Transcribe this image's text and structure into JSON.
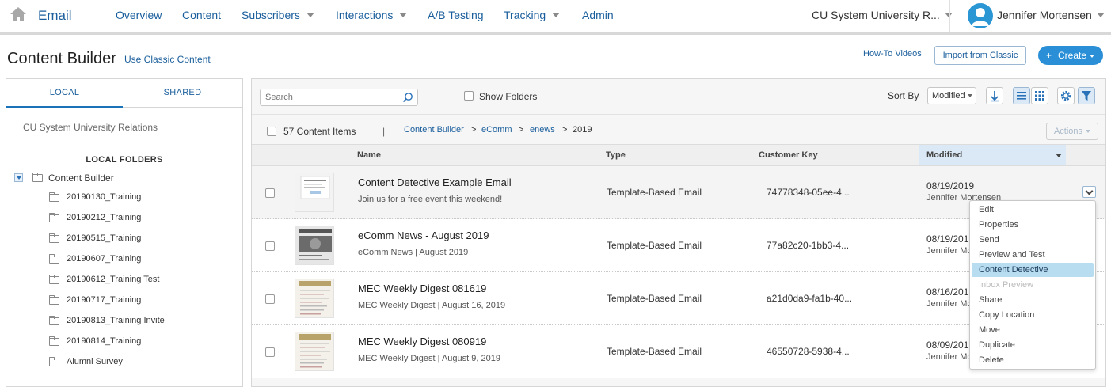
{
  "nav": {
    "app_name": "Email",
    "items": [
      {
        "label": "Overview",
        "has_caret": false
      },
      {
        "label": "Content",
        "has_caret": false
      },
      {
        "label": "Subscribers",
        "has_caret": true
      },
      {
        "label": "Interactions",
        "has_caret": true
      },
      {
        "label": "A/B Testing",
        "has_caret": false
      },
      {
        "label": "Tracking",
        "has_caret": true
      },
      {
        "label": "Admin",
        "has_caret": false
      }
    ],
    "business_unit": "CU System University R...",
    "user_name": "Jennifer Mortensen",
    "icons": {
      "home": "home-icon",
      "avatar": "user-avatar-icon"
    }
  },
  "header": {
    "title": "Content Builder",
    "classic_link": "Use Classic Content",
    "howto_link": "How-To Videos",
    "import_button": "Import from Classic",
    "create_button": "Create",
    "create_icon": "+"
  },
  "sidebar": {
    "tabs": [
      {
        "label": "LOCAL",
        "active": true
      },
      {
        "label": "SHARED",
        "active": false
      }
    ],
    "business_unit": "CU System University Relations",
    "section_title": "LOCAL FOLDERS",
    "root": "Content Builder",
    "folders": [
      "20190130_Training",
      "20190212_Training",
      "20190515_Training",
      "20190607_Training",
      "20190612_Training Test",
      "20190717_Training",
      "20190813_Training Invite",
      "20190814_Training",
      "Alumni Survey"
    ]
  },
  "toolbar": {
    "search_placeholder": "Search",
    "show_folders_label": "Show Folders",
    "show_folders_checked": false,
    "sort_by_label": "Sort By",
    "sort_value": "Modified",
    "view_mode": "list"
  },
  "listing": {
    "count_label": "57 Content Items",
    "pipe": "|",
    "breadcrumb": [
      "Content Builder",
      "eComm",
      "enews",
      "2019"
    ],
    "breadcrumb_sep": ">",
    "actions_label": "Actions",
    "columns": {
      "name": "Name",
      "type": "Type",
      "key": "Customer Key",
      "modified": "Modified"
    },
    "sort_column": "Modified",
    "rows": [
      {
        "name": "Content Detective Example Email",
        "sub": "Join us for a free event this weekend!",
        "type": "Template-Based Email",
        "key": "74778348-05ee-4...",
        "date": "08/19/2019",
        "user": "Jennifer Mortensen"
      },
      {
        "name": "eComm News - August 2019",
        "sub": "eComm News | August 2019",
        "type": "Template-Based Email",
        "key": "77a82c20-1bb3-4...",
        "date": "08/19/201",
        "user": "Jennifer Mo"
      },
      {
        "name": "MEC Weekly Digest 081619",
        "sub": "MEC Weekly Digest | August 16, 2019",
        "type": "Template-Based Email",
        "key": "a21d0da9-fa1b-40...",
        "date": "08/16/201",
        "user": "Jennifer Mo"
      },
      {
        "name": "MEC Weekly Digest 080919",
        "sub": "MEC Weekly Digest | August 9, 2019",
        "type": "Template-Based Email",
        "key": "46550728-5938-4...",
        "date": "08/09/201",
        "user": "Jennifer Mo"
      }
    ]
  },
  "context_menu": {
    "items": [
      {
        "label": "Edit",
        "state": "normal"
      },
      {
        "label": "Properties",
        "state": "normal"
      },
      {
        "label": "Send",
        "state": "normal"
      },
      {
        "label": "Preview and Test",
        "state": "normal"
      },
      {
        "label": "Content Detective",
        "state": "highlighted"
      },
      {
        "label": "Inbox Preview",
        "state": "disabled"
      },
      {
        "label": "Share",
        "state": "normal"
      },
      {
        "label": "Copy Location",
        "state": "normal"
      },
      {
        "label": "Move",
        "state": "normal"
      },
      {
        "label": "Duplicate",
        "state": "normal"
      },
      {
        "label": "Delete",
        "state": "normal"
      }
    ]
  },
  "colors": {
    "accent": "#1a5e9c",
    "primary_button": "#2a8fd6",
    "highlight": "#b8dcf0"
  }
}
